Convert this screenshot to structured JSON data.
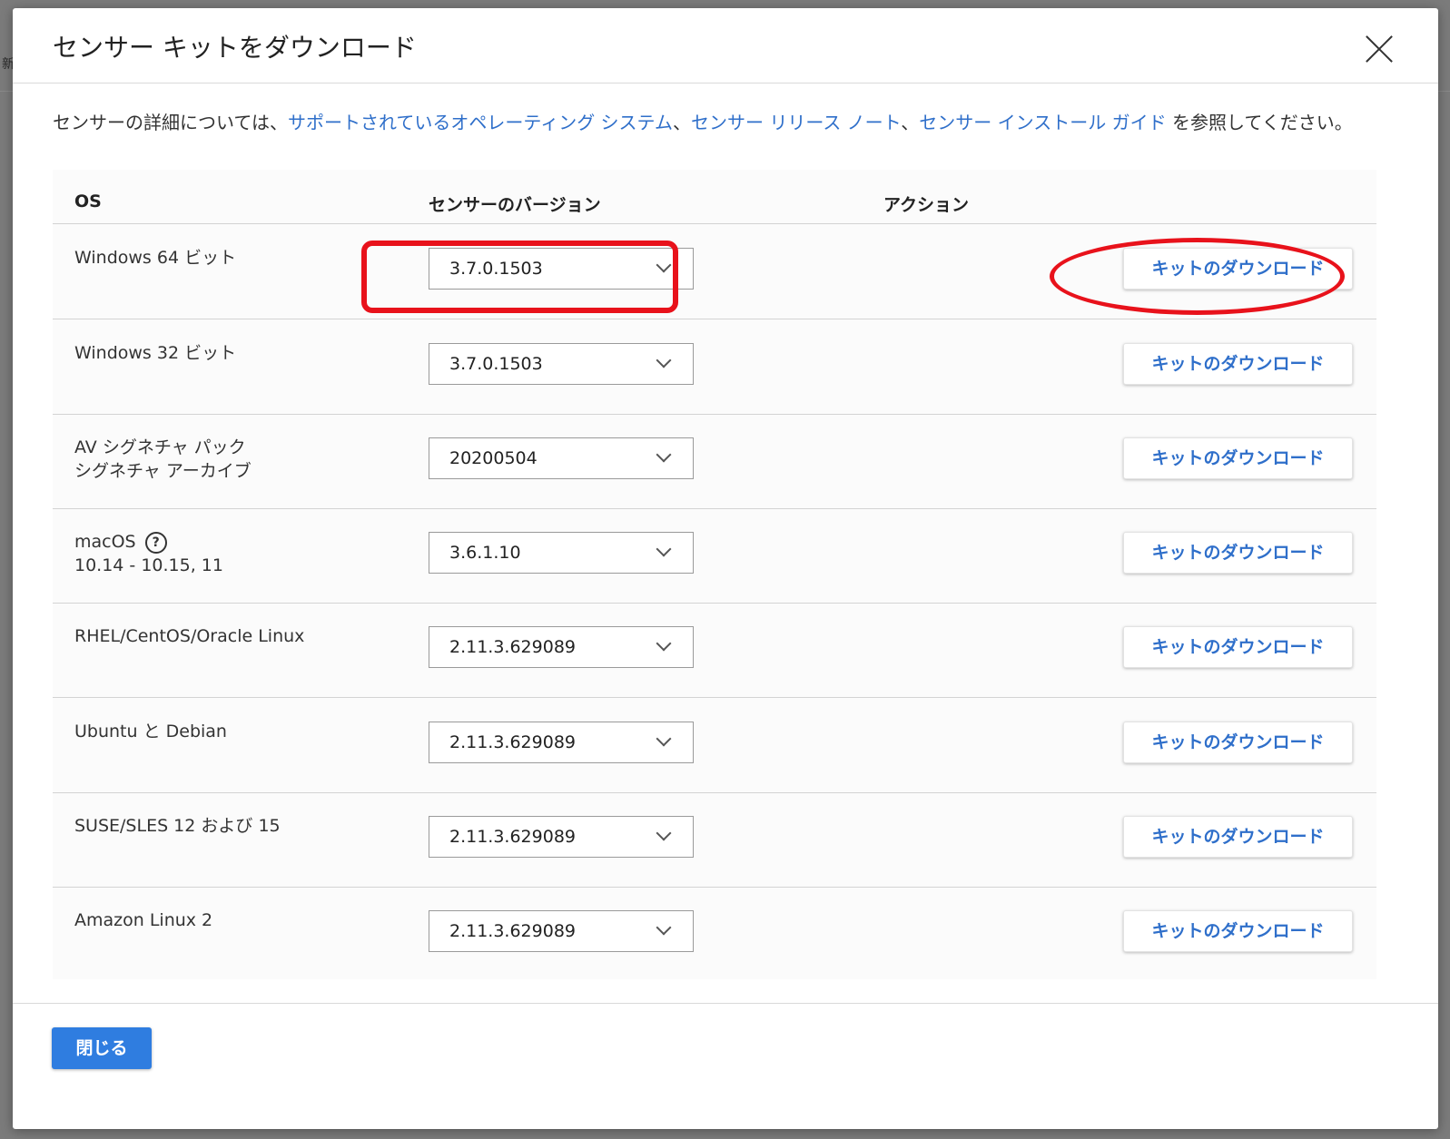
{
  "background": {
    "glyph": "新"
  },
  "modal": {
    "title": "センサー キットをダウンロード",
    "close_icon": "close-icon",
    "intro": {
      "prefix": "センサーの詳細については、",
      "link1": "サポートされているオペレーティング システム",
      "sep1": "、",
      "link2": "センサー リリース ノート",
      "sep2": "、",
      "link3": "センサー インストール ガイド",
      "suffix": " を参照してください。"
    },
    "table": {
      "headers": {
        "os": "OS",
        "version": "センサーのバージョン",
        "action": "アクション"
      },
      "rows": [
        {
          "os": "Windows 64 ビット",
          "os_sub": "",
          "version": "3.7.0.1503",
          "action": "キットのダウンロード"
        },
        {
          "os": "Windows 32 ビット",
          "os_sub": "",
          "version": "3.7.0.1503",
          "action": "キットのダウンロード"
        },
        {
          "os": "AV シグネチャ パック",
          "os_sub": "シグネチャ アーカイブ",
          "version": "20200504",
          "action": "キットのダウンロード"
        },
        {
          "os": "macOS",
          "os_sub": "10.14 - 10.15, 11",
          "version": "3.6.1.10",
          "action": "キットのダウンロード",
          "help": "?"
        },
        {
          "os": "RHEL/CentOS/Oracle Linux",
          "os_sub": "",
          "version": "2.11.3.629089",
          "action": "キットのダウンロード"
        },
        {
          "os": "Ubuntu と Debian",
          "os_sub": "",
          "version": "2.11.3.629089",
          "action": "キットのダウンロード"
        },
        {
          "os": "SUSE/SLES 12 および 15",
          "os_sub": "",
          "version": "2.11.3.629089",
          "action": "キットのダウンロード"
        },
        {
          "os": "Amazon Linux 2",
          "os_sub": "",
          "version": "2.11.3.629089",
          "action": "キットのダウンロード"
        }
      ]
    },
    "footer": {
      "close_label": "閉じる"
    },
    "highlight_color": "#e8121b",
    "link_color": "#2f6fca",
    "primary_color": "#2f7de0"
  }
}
